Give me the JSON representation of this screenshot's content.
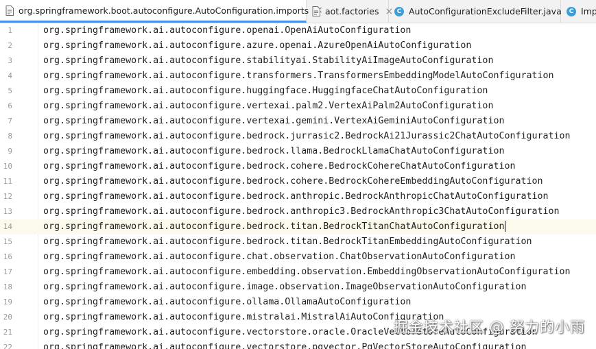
{
  "tabs": [
    {
      "label": "org.springframework.boot.autoconfigure.AutoConfiguration.imports",
      "icon": "file-icon",
      "active": true
    },
    {
      "label": "aot.factories",
      "icon": "file-icon",
      "active": false
    },
    {
      "label": "AutoConfigurationExcludeFilter.java",
      "icon": "class-icon",
      "active": false
    },
    {
      "label": "Imp",
      "icon": "class-icon",
      "active": false
    }
  ],
  "tab_class_letter": "C",
  "close_glyph": "×",
  "editor": {
    "current_line": 14,
    "lines": [
      {
        "num": "1",
        "text": "org.springframework.ai.autoconfigure.openai.OpenAiAutoConfiguration"
      },
      {
        "num": "2",
        "text": "org.springframework.ai.autoconfigure.azure.openai.AzureOpenAiAutoConfiguration"
      },
      {
        "num": "3",
        "text": "org.springframework.ai.autoconfigure.stabilityai.StabilityAiImageAutoConfiguration"
      },
      {
        "num": "4",
        "text": "org.springframework.ai.autoconfigure.transformers.TransformersEmbeddingModelAutoConfiguration"
      },
      {
        "num": "5",
        "text": "org.springframework.ai.autoconfigure.huggingface.HuggingfaceChatAutoConfiguration"
      },
      {
        "num": "6",
        "text": "org.springframework.ai.autoconfigure.vertexai.palm2.VertexAiPalm2AutoConfiguration"
      },
      {
        "num": "7",
        "text": "org.springframework.ai.autoconfigure.vertexai.gemini.VertexAiGeminiAutoConfiguration"
      },
      {
        "num": "8",
        "text": "org.springframework.ai.autoconfigure.bedrock.jurrasic2.BedrockAi21Jurassic2ChatAutoConfiguration"
      },
      {
        "num": "9",
        "text": "org.springframework.ai.autoconfigure.bedrock.llama.BedrockLlamaChatAutoConfiguration"
      },
      {
        "num": "10",
        "text": "org.springframework.ai.autoconfigure.bedrock.cohere.BedrockCohereChatAutoConfiguration"
      },
      {
        "num": "11",
        "text": "org.springframework.ai.autoconfigure.bedrock.cohere.BedrockCohereEmbeddingAutoConfiguration"
      },
      {
        "num": "12",
        "text": "org.springframework.ai.autoconfigure.bedrock.anthropic.BedrockAnthropicChatAutoConfiguration"
      },
      {
        "num": "13",
        "text": "org.springframework.ai.autoconfigure.bedrock.anthropic3.BedrockAnthropic3ChatAutoConfiguration"
      },
      {
        "num": "14",
        "text": "org.springframework.ai.autoconfigure.bedrock.titan.BedrockTitanChatAutoConfiguration"
      },
      {
        "num": "15",
        "text": "org.springframework.ai.autoconfigure.bedrock.titan.BedrockTitanEmbeddingAutoConfiguration"
      },
      {
        "num": "16",
        "text": "org.springframework.ai.autoconfigure.chat.observation.ChatObservationAutoConfiguration"
      },
      {
        "num": "17",
        "text": "org.springframework.ai.autoconfigure.embedding.observation.EmbeddingObservationAutoConfiguration"
      },
      {
        "num": "18",
        "text": "org.springframework.ai.autoconfigure.image.observation.ImageObservationAutoConfiguration"
      },
      {
        "num": "19",
        "text": "org.springframework.ai.autoconfigure.ollama.OllamaAutoConfiguration"
      },
      {
        "num": "20",
        "text": "org.springframework.ai.autoconfigure.mistralai.MistralAiAutoConfiguration"
      },
      {
        "num": "21",
        "text": "org.springframework.ai.autoconfigure.vectorstore.oracle.OracleVectorStoreAutoConfiguration"
      },
      {
        "num": "22",
        "text": "org.springframework.ai.autoconfigure.vectorstore.pgvector.PgVectorStoreAutoConfiguration"
      }
    ]
  },
  "watermark": "掘金技术社区 @ 努力的小雨",
  "colors": {
    "active_tab_underline": "#4a8ee6",
    "current_line_bg": "#fcfaed",
    "class_icon": "#3d9ed8"
  }
}
